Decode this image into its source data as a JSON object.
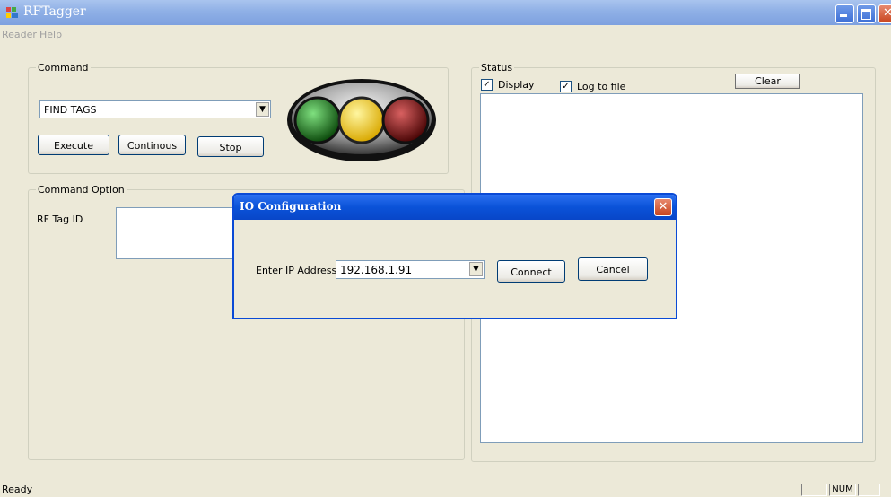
{
  "window": {
    "title": "RFTagger",
    "min_icon": "minimize-icon",
    "max_icon": "maximize-icon",
    "close_icon": "close-icon"
  },
  "menu": {
    "items": [
      "Reader",
      "Help"
    ]
  },
  "command": {
    "legend": "Command",
    "selected": "FIND TAGS",
    "execute_label": "Execute",
    "continous_label": "Continous",
    "stop_label": "Stop",
    "lights": [
      "green",
      "yellow",
      "red"
    ],
    "light_colors": {
      "green": "#1f8a1f",
      "yellow": "#f4d20c",
      "red": "#9a1414"
    }
  },
  "command_option": {
    "legend": "Command Option",
    "rf_tag_label": "RF Tag ID",
    "rf_tag_value": ""
  },
  "status": {
    "legend": "Status",
    "display_label": "Display",
    "display_checked": true,
    "log_label": "Log to file",
    "log_checked": true,
    "clear_label": "Clear"
  },
  "statusbar": {
    "text": "Ready",
    "num_label": "NUM"
  },
  "dialog": {
    "title": "IO Configuration",
    "ip_label": "Enter IP Address",
    "ip_value": "192.168.1.91",
    "connect_label": "Connect",
    "cancel_label": "Cancel"
  }
}
